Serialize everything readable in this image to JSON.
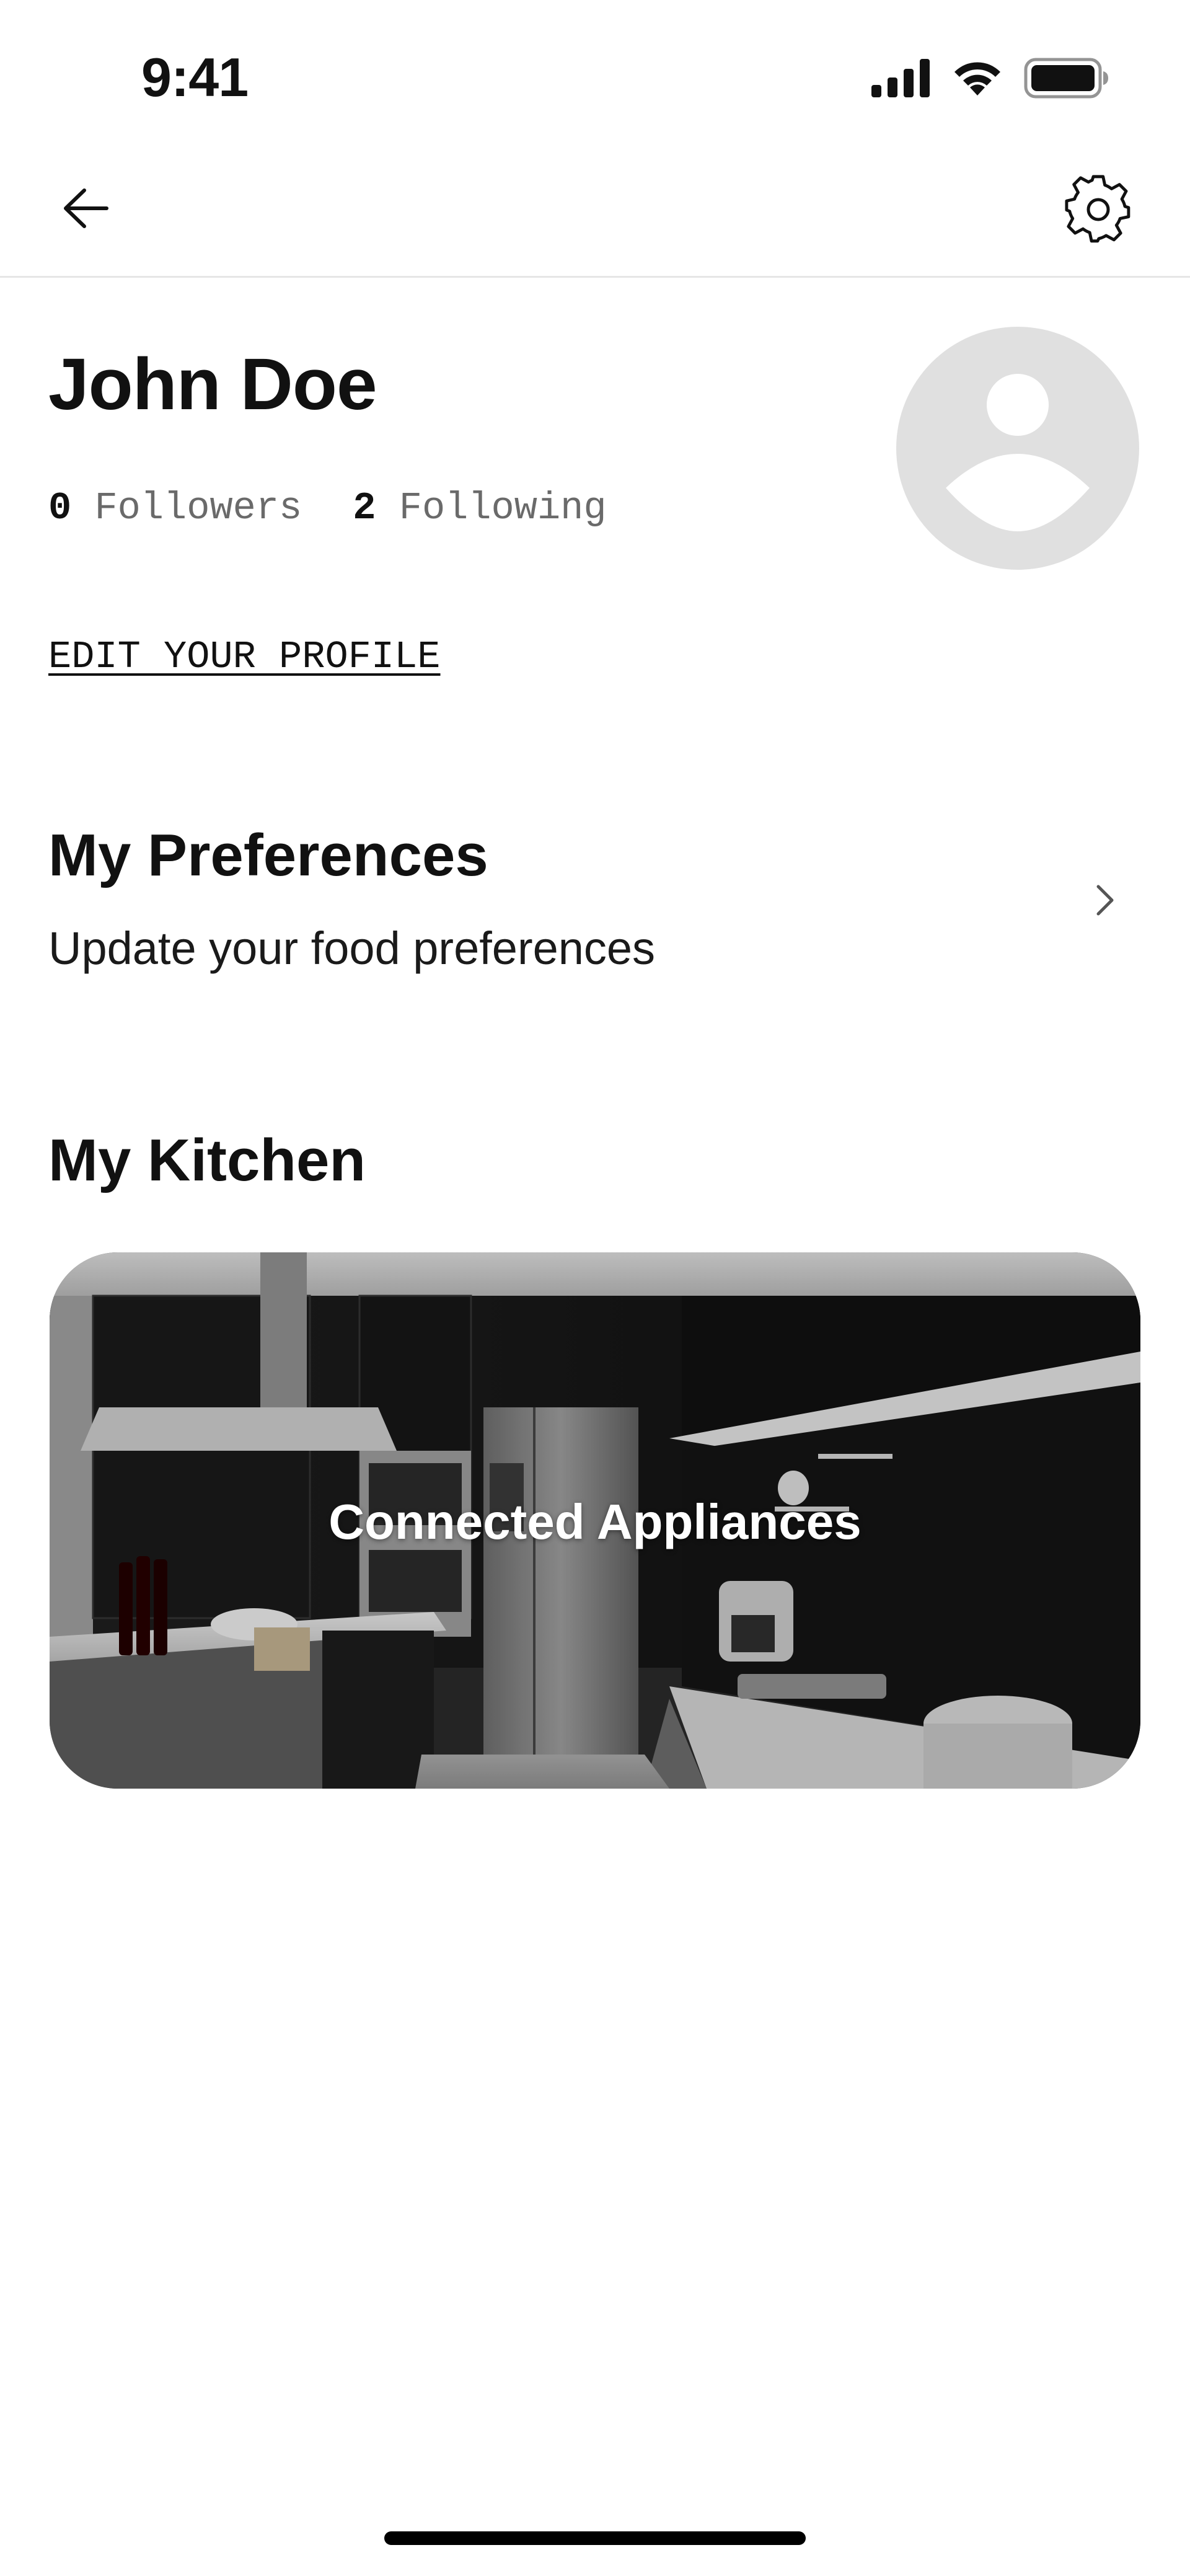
{
  "status_bar": {
    "time": "9:41",
    "icons": [
      "cellular-signal-icon",
      "wifi-icon",
      "battery-icon"
    ]
  },
  "nav": {
    "back_icon": "arrow-left-icon",
    "settings_icon": "gear-icon"
  },
  "profile": {
    "name": "John Doe",
    "followers_count": "0",
    "followers_label": "Followers",
    "following_count": "2",
    "following_label": "Following",
    "avatar_icon": "user-placeholder-icon",
    "edit_label": "EDIT YOUR PROFILE"
  },
  "preferences": {
    "title": "My Preferences",
    "subtitle": "Update your food preferences",
    "chevron_icon": "chevron-right-icon"
  },
  "kitchen": {
    "title": "My Kitchen",
    "card_label": "Connected Appliances"
  },
  "colors": {
    "text": "#111111",
    "muted_text": "#6a6a6a",
    "avatar_bg": "#e0e0e0",
    "divider": "#e6e6e6"
  }
}
